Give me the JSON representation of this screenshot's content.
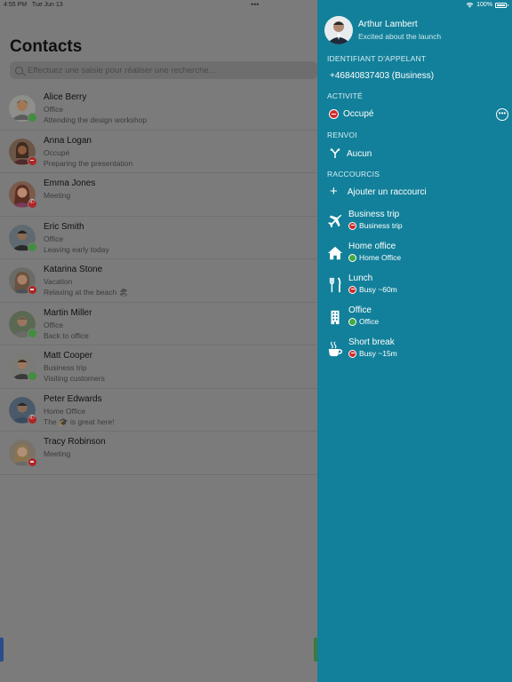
{
  "status_bar": {
    "time": "4:55 PM",
    "date": "Tue Jun 13",
    "dots": "•••",
    "battery": "100%"
  },
  "contacts": {
    "title": "Contacts",
    "search_placeholder": "Effectuez une saisie pour réaliser une recherche...",
    "rows": [
      {
        "name": "Alice Berry",
        "line1": "Office",
        "line2": "Attending the design workshop",
        "presence": "green"
      },
      {
        "name": "Anna Logan",
        "line1": "Occupé",
        "line2": "Preparing the presentation",
        "presence": "red"
      },
      {
        "name": "Emma Jones",
        "line1": "Meeting",
        "line2": "",
        "presence": "phone"
      },
      {
        "name": "Eric Smith",
        "line1": "Office",
        "line2": "Leaving early today",
        "presence": "green"
      },
      {
        "name": "Katarina Stone",
        "line1": "Vacation",
        "line2": "Relaxing at the beach 🏖",
        "presence": "red"
      },
      {
        "name": "Martin Miller",
        "line1": "Office",
        "line2": "Back to office",
        "presence": "green"
      },
      {
        "name": "Matt Cooper",
        "line1": "Business trip",
        "line2": "Visiting customers",
        "presence": "green"
      },
      {
        "name": "Peter Edwards",
        "line1": "Home Office",
        "line2": "The 🎓 is great here!",
        "presence": "phone"
      },
      {
        "name": "Tracy Robinson",
        "line1": "Meeting",
        "line2": "",
        "presence": "red"
      }
    ]
  },
  "panel": {
    "profile": {
      "name": "Arthur Lambert",
      "status": "Excited about the launch"
    },
    "caller_id": {
      "header": "IDENTIFIANT D'APPELANT",
      "value": "+46840837403 (Business)"
    },
    "activity": {
      "header": "ACTIVITÉ",
      "value": "Occupé"
    },
    "forward": {
      "header": "RENVOI",
      "value": "Aucun"
    },
    "shortcuts": {
      "header": "RACCOURCIS",
      "add_label": "Ajouter un raccourci",
      "items": [
        {
          "title": "Business trip",
          "status": "Business trip",
          "icon": "airplane-icon",
          "dot": "red"
        },
        {
          "title": "Home office",
          "status": "Home Office",
          "icon": "house-icon",
          "dot": "green"
        },
        {
          "title": "Lunch",
          "status": "Busy ~60m",
          "icon": "fork-knife-icon",
          "dot": "red"
        },
        {
          "title": "Office",
          "status": "Office",
          "icon": "building-icon",
          "dot": "green"
        },
        {
          "title": "Short break",
          "status": "Busy ~15m",
          "icon": "coffee-cup-icon",
          "dot": "red"
        }
      ]
    }
  }
}
